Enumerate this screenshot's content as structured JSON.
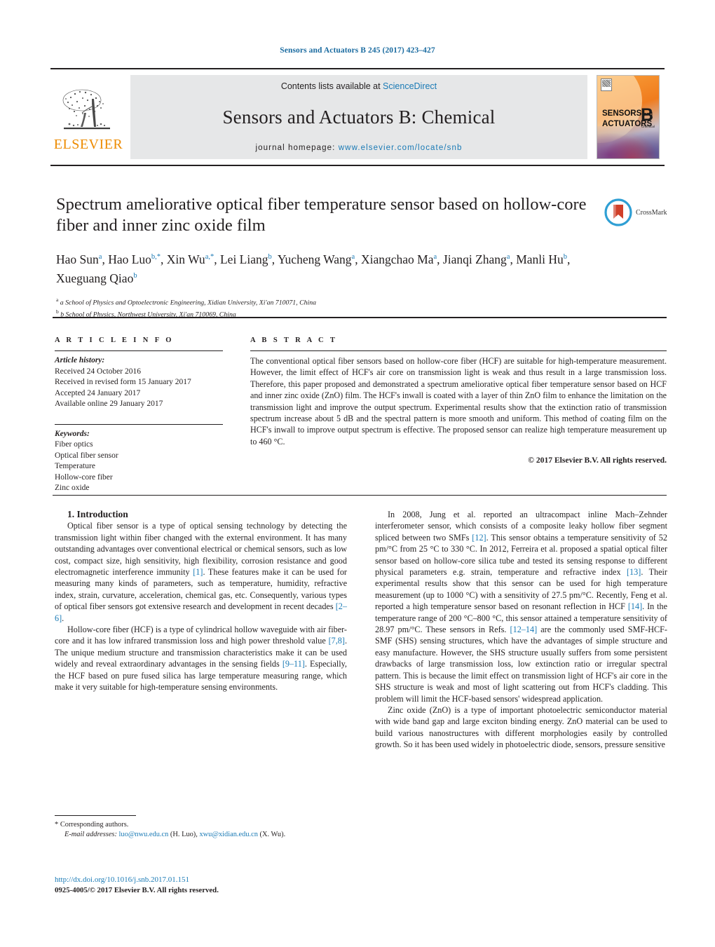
{
  "running_head": "Sensors and Actuators B 245 (2017) 423–427",
  "masthead": {
    "publisher_name": "ELSEVIER",
    "contents_prefix": "Contents lists available at ",
    "contents_link": "ScienceDirect",
    "journal_title": "Sensors and Actuators B: Chemical",
    "homepage_prefix": "journal homepage: ",
    "homepage_url": "www.elsevier.com/locate/snb",
    "cover": {
      "line1": "SENSORS",
      "and": "and",
      "line2": "ACTUATORS",
      "letter": "B",
      "sub": "Chemical"
    }
  },
  "title": "Spectrum ameliorative optical fiber temperature sensor based on hollow-core fiber and inner zinc oxide film",
  "crossmark_label": "CrossMark",
  "authors_html": "Hao Sun<sup>a</sup>, Hao Luo<sup>b,*</sup>, Xin Wu<sup>a,*</sup>, Lei Liang<sup>b</sup>, Yucheng Wang<sup>a</sup>, Xiangchao Ma<sup>a</sup>, Jianqi Zhang<sup>a</sup>, Manli Hu<sup>b</sup>, Xueguang Qiao<sup>b</sup>",
  "affiliations": [
    "a School of Physics and Optoelectronic Engineering, Xidian University, Xi'an 710071, China",
    "b School of Physics, Northwest University, Xi'an 710069, China"
  ],
  "article_info": {
    "heading": "A R T I C L E   I N F O",
    "history_label": "Article history:",
    "history": [
      "Received 24 October 2016",
      "Received in revised form 15 January 2017",
      "Accepted 24 January 2017",
      "Available online 29 January 2017"
    ],
    "keywords_label": "Keywords:",
    "keywords": [
      "Fiber optics",
      "Optical fiber sensor",
      "Temperature",
      "Hollow-core fiber",
      "Zinc oxide"
    ]
  },
  "abstract": {
    "heading": "A B S T R A C T",
    "text": "The conventional optical fiber sensors based on hollow-core fiber (HCF) are suitable for high-temperature measurement. However, the limit effect of HCF's air core on transmission light is weak and thus result in a large transmission loss. Therefore, this paper proposed and demonstrated a spectrum ameliorative optical fiber temperature sensor based on HCF and inner zinc oxide (ZnO) film. The HCF's inwall is coated with a layer of thin ZnO film to enhance the limitation on the transmission light and improve the output spectrum. Experimental results show that the extinction ratio of transmission spectrum increase about 5 dB and the spectral pattern is more smooth and uniform. This method of coating film on the HCF's inwall to improve output spectrum is effective. The proposed sensor can realize high temperature measurement up to 460 °C.",
    "copyright": "© 2017 Elsevier B.V. All rights reserved."
  },
  "body": {
    "section_title": "1.  Introduction",
    "left_paragraphs": [
      "Optical fiber sensor is a type of optical sensing technology by detecting the transmission light within fiber changed with the external environment. It has many outstanding advantages over conventional electrical or chemical sensors, such as low cost, compact size, high sensitivity, high flexibility, corrosion resistance and good electromagnetic interference immunity [1]. These features make it can be used for measuring many kinds of parameters, such as temperature, humidity, refractive index, strain, curvature, acceleration, chemical gas, etc. Consequently, various types of optical fiber sensors got extensive research and development in recent decades [2–6].",
      "Hollow-core fiber (HCF) is a type of cylindrical hollow waveguide with air fiber-core and it has low infrared transmission loss and high power threshold value [7,8]. The unique medium structure and transmission characteristics make it can be used widely and reveal extraordinary advantages in the sensing fields [9–11]. Especially, the HCF based on pure fused silica has large temperature measuring range, which make it very suitable for high-temperature sensing environments."
    ],
    "right_paragraphs": [
      "In 2008, Jung et al. reported an ultracompact inline Mach–Zehnder interferometer sensor, which consists of a composite leaky hollow fiber segment spliced between two SMFs [12]. This sensor obtains a temperature sensitivity of 52 pm/°C from 25 °C to 330 °C. In 2012, Ferreira et al. proposed a spatial optical filter sensor based on hollow-core silica tube and tested its sensing response to different physical parameters e.g. strain, temperature and refractive index [13]. Their experimental results show that this sensor can be used for high temperature measurement (up to 1000 °C) with a sensitivity of 27.5 pm/°C. Recently, Feng et al. reported a high temperature sensor based on resonant reflection in HCF [14]. In the temperature range of 200 °C–800 °C, this sensor attained a temperature sensitivity of 28.97 pm/°C. These sensors in Refs. [12–14] are the commonly used SMF-HCF-SMF (SHS) sensing structures, which have the advantages of simple structure and easy manufacture. However, the SHS structure usually suffers from some persistent drawbacks of large transmission loss, low extinction ratio or irregular spectral pattern. This is because the limit effect on transmission light of HCF's air core in the SHS structure is weak and most of light scattering out from HCF's cladding. This problem will limit the HCF-based sensors' widespread application.",
      "Zinc oxide (ZnO) is a type of important photoelectric semiconductor material with wide band gap and large exciton binding energy. ZnO material can be used to build various nanostructures with different morphologies easily by controlled growth. So it has been used widely in photoelectric diode, sensors, pressure sensitive"
    ]
  },
  "footnote": {
    "star": "*",
    "corresponding": "Corresponding authors.",
    "email_label": "E-mail addresses:",
    "email1": "luo@nwu.edu.cn",
    "email1_name": "(H. Luo),",
    "email2": "xwu@xidian.edu.cn",
    "email2_name": "(X. Wu)."
  },
  "doi": "http://dx.doi.org/10.1016/j.snb.2017.01.151",
  "issn_line": "0925-4005/© 2017 Elsevier B.V. All rights reserved.",
  "colors": {
    "link": "#1a7ab5",
    "elsevier_orange": "#ED8B00",
    "header_blue": "#1a6ba0"
  }
}
